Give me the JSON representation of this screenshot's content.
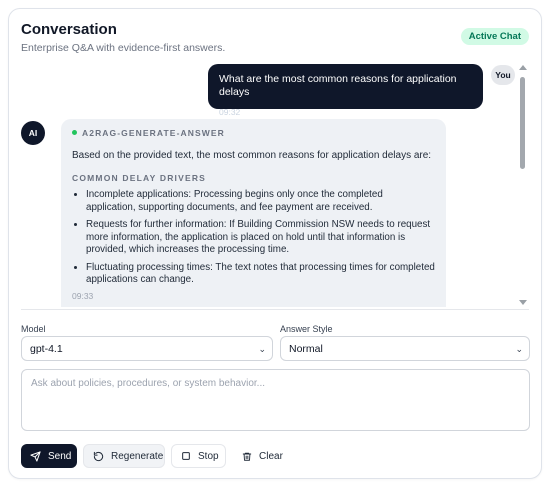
{
  "header": {
    "title": "Conversation",
    "subtitle": "Enterprise Q&A with evidence-first answers.",
    "badge": "Active Chat"
  },
  "messages": {
    "user": {
      "text": "What are the most common reasons for application delays",
      "time": "09:32",
      "avatar": "You"
    },
    "assistant": {
      "avatar": "AI",
      "tool_label": "A2RAG-GENERATE-ANSWER",
      "intro": "Based on the provided text, the most common reasons for application delays are:",
      "section_title": "COMMON DELAY DRIVERS",
      "bullets": [
        "Incomplete applications: Processing begins only once the completed application, supporting documents, and fee payment are received.",
        "Requests for further information: If Building Commission NSW needs to request more information, the application is placed on hold until that information is provided, which increases the processing time.",
        "Fluctuating processing times: The text notes that processing times for completed applications can change."
      ],
      "time": "09:33"
    }
  },
  "controls": {
    "model_label": "Model",
    "model_value": "gpt-4.1",
    "style_label": "Answer Style",
    "style_value": "Normal",
    "input_placeholder": "Ask about policies, procedures, or system behavior..."
  },
  "buttons": {
    "send": "Send",
    "regenerate": "Regenerate",
    "stop": "Stop",
    "clear": "Clear"
  },
  "icons": {
    "send": "send-icon",
    "regenerate": "refresh-icon",
    "stop": "stop-icon",
    "clear": "trash-icon"
  },
  "colors": {
    "accent": "#0f172a",
    "badge_bg": "#d1fae5",
    "badge_text": "#047857",
    "assistant_bubble": "#eef1f5"
  }
}
